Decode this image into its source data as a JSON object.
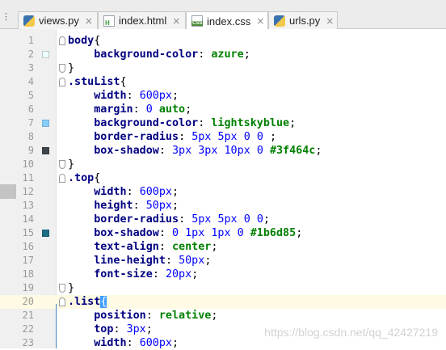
{
  "tabs": [
    {
      "label": "views.py",
      "icon": "python-file-icon",
      "active": false
    },
    {
      "label": "index.html",
      "icon": "html-file-icon",
      "active": false
    },
    {
      "label": "index.css",
      "icon": "css-file-icon",
      "active": true
    },
    {
      "label": "urls.py",
      "icon": "python-file-icon",
      "active": false
    }
  ],
  "close_glyph": "×",
  "watermark": "https://blog.csdn.net/qq_42427219",
  "colors": {
    "azure": "#f0ffff",
    "lightskyblue": "#87cefa",
    "shadow1": "#3f464c",
    "shadow2": "#1b6d85"
  },
  "lines": [
    {
      "n": "1",
      "text": "body{"
    },
    {
      "n": "2",
      "text": "    background-color: azure;"
    },
    {
      "n": "3",
      "text": "}"
    },
    {
      "n": "4",
      "text": ".stuList{"
    },
    {
      "n": "5",
      "text": "    width: 600px;"
    },
    {
      "n": "6",
      "text": "    margin: 0 auto;"
    },
    {
      "n": "7",
      "text": "    background-color: lightskyblue;"
    },
    {
      "n": "8",
      "text": "    border-radius: 5px 5px 0 0 ;"
    },
    {
      "n": "9",
      "text": "    box-shadow: 3px 3px 10px 0 #3f464c;"
    },
    {
      "n": "10",
      "text": "}"
    },
    {
      "n": "11",
      "text": ".top{"
    },
    {
      "n": "12",
      "text": "    width: 600px;"
    },
    {
      "n": "13",
      "text": "    height: 50px;"
    },
    {
      "n": "14",
      "text": "    border-radius: 5px 5px 0 0;"
    },
    {
      "n": "15",
      "text": "    box-shadow: 0 1px 1px 0 #1b6d85;"
    },
    {
      "n": "16",
      "text": "    text-align: center;"
    },
    {
      "n": "17",
      "text": "    line-height: 50px;"
    },
    {
      "n": "18",
      "text": "    font-size: 20px;"
    },
    {
      "n": "19",
      "text": "}"
    },
    {
      "n": "20",
      "text": ".list{"
    },
    {
      "n": "21",
      "text": "    position: relative;"
    },
    {
      "n": "22",
      "text": "    top: 3px;"
    },
    {
      "n": "23",
      "text": "    width: 600px;"
    }
  ]
}
